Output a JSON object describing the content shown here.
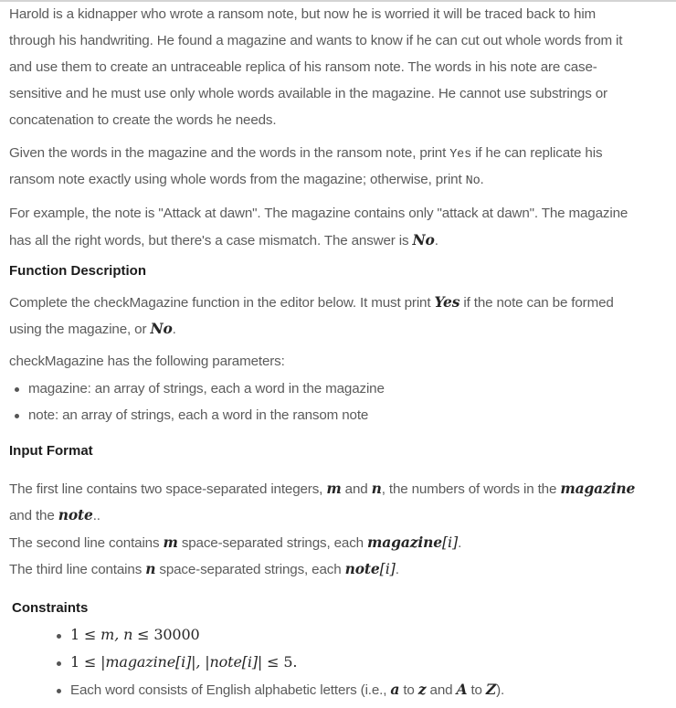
{
  "intro": {
    "lines": [
      "Harold is a kidnapper who wrote a ransom note, but now he is worried it will be traced back to him",
      "through his handwriting. He found a magazine and wants to know if he can cut out whole words from it",
      "and use them to create an untraceable replica of his ransom note. The words in his note are case-",
      "sensitive and he must use only whole words available in the magazine. He cannot use substrings or",
      "concatenation to create the words he needs."
    ]
  },
  "task": {
    "line1_a": "Given the words in the magazine and the words in the ransom note, print ",
    "line1_code": "Yes",
    "line1_b": " if he can replicate his",
    "line2_a": "ransom note exactly using whole words from the magazine; otherwise, print ",
    "line2_code": "No",
    "line2_b": "."
  },
  "example": {
    "line1": "For example, the note is \"Attack at dawn\". The magazine contains only \"attack at dawn\". The magazine",
    "line2_a": "has all the right words, but there's a case mismatch. The answer is ",
    "line2_math": "No",
    "line2_b": "."
  },
  "function_description": {
    "heading": "Function Description",
    "line1_a": "Complete the checkMagazine function in the editor below. It must print ",
    "line1_math": "Yes",
    "line1_b": " if the note can be formed",
    "line2_a": "using the magazine, or ",
    "line2_math": "No",
    "line2_b": ".",
    "params_intro": "checkMagazine has the following parameters:",
    "params": [
      "magazine: an array of strings, each a word in the magazine",
      "note: an array of strings, each a word in the ransom note"
    ]
  },
  "input_format": {
    "heading": "Input Format",
    "line1_a": "The first line contains two space-separated integers, ",
    "line1_m": "m",
    "line1_and": " and ",
    "line1_n": "n",
    "line1_b": ", the numbers of words in the ",
    "line1_mag": "magazine",
    "line2_a": "and the ",
    "line2_note": "note",
    "line2_b": "..",
    "line3_a": "The second line contains ",
    "line3_m": "m",
    "line3_b": " space-separated strings, each ",
    "line3_expr": "magazine",
    "line3_idx": "[i]",
    "line3_c": ".",
    "line4_a": "The third line contains ",
    "line4_n": "n",
    "line4_b": " space-separated strings, each ",
    "line4_expr": "note",
    "line4_idx": "[i]",
    "line4_c": "."
  },
  "constraints": {
    "heading": "Constraints",
    "c1": {
      "one": "1",
      "le1": " ≤ ",
      "vars": "m, n",
      "le2": " ≤ ",
      "max": "30000"
    },
    "c2": {
      "one": "1",
      "le1": " ≤ ",
      "expr1": "|magazine[i]|, |note[i]|",
      "le2": " ≤ ",
      "max": "5."
    },
    "c3": {
      "a": "Each word consists of English alphabetic letters (i.e., ",
      "v1": "a",
      "to1": " to ",
      "v2": "z",
      "and": " and ",
      "v3": "A",
      "to2": " to ",
      "v4": "Z",
      "end": ")."
    }
  }
}
